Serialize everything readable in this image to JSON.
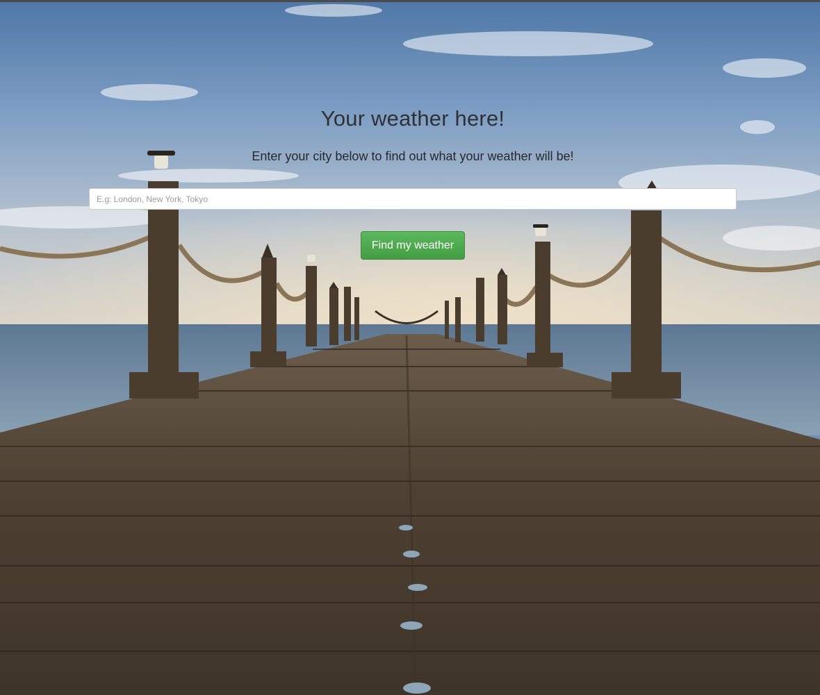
{
  "page": {
    "title": "Your weather here!",
    "subtitle": "Enter your city below to find out what your weather will be!"
  },
  "search": {
    "placeholder": "E.g: London, New York, Tokyo",
    "value": ""
  },
  "actions": {
    "find_label": "Find my weather"
  },
  "colors": {
    "button_green": "#5cb85c",
    "title_text": "#2e3237"
  },
  "background": {
    "subject": "wooden-pier-over-sea-at-dusk"
  }
}
